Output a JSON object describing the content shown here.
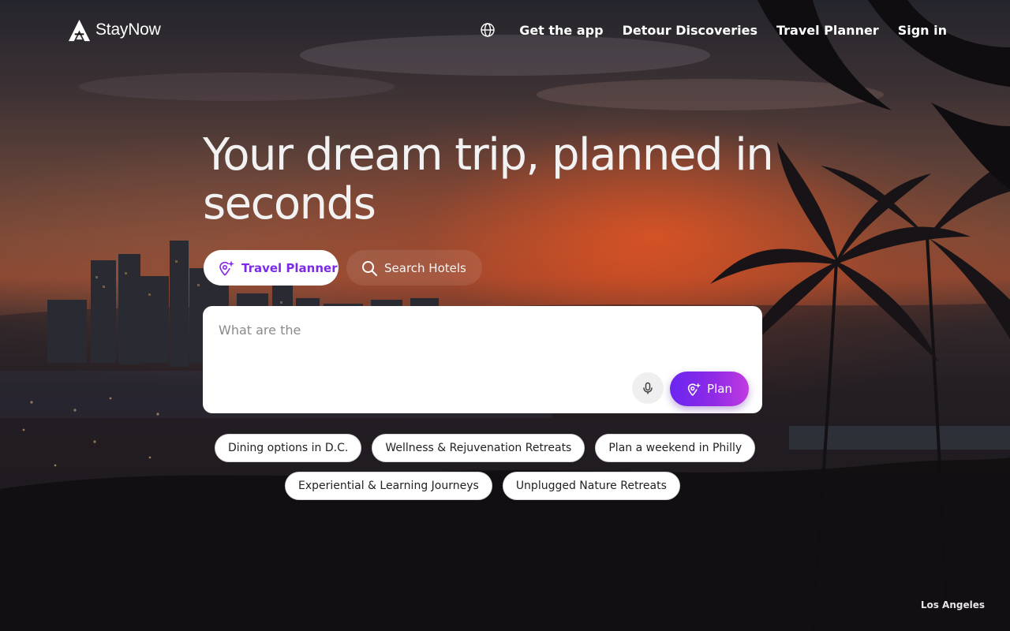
{
  "brand": {
    "name": "StayNow",
    "logo_icon": "mountain-a-logo"
  },
  "nav": {
    "globe_icon": "globe-icon",
    "links": [
      "Get the app",
      "Detour Discoveries",
      "Travel Planner",
      "Sign in"
    ]
  },
  "hero": {
    "headline": "Your dream trip, planned in seconds",
    "location_caption": "Los Angeles"
  },
  "mode_tabs": [
    {
      "label": "Travel Planner",
      "icon": "sparkle-pin-icon",
      "active": true
    },
    {
      "label": "Search Hotels",
      "icon": "search-icon",
      "active": false
    }
  ],
  "planner": {
    "placeholder": "What are the",
    "value": "",
    "mic_icon": "microphone-icon",
    "plan_label": "Plan",
    "plan_icon": "sparkle-pin-icon"
  },
  "suggestions": {
    "row1": [
      "Dining options in D.C.",
      "Wellness & Rejuvenation Retreats",
      "Plan a weekend in Philly"
    ],
    "row2": [
      "Experiential & Learning Journeys",
      "Unplugged Nature Retreats"
    ]
  },
  "colors": {
    "accent": "#7b2be6",
    "plan_gradient_start": "#6a26f0",
    "plan_gradient_end": "#c13be0"
  }
}
